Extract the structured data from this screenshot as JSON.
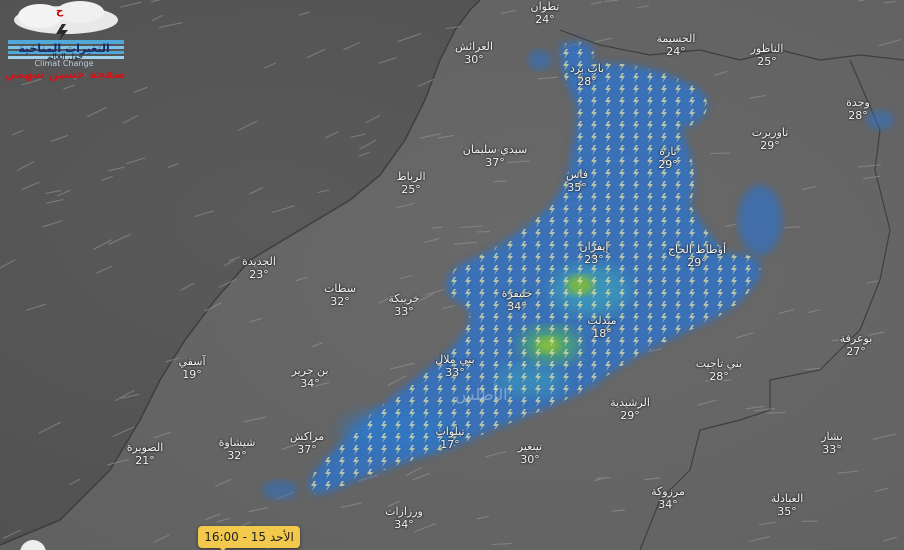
{
  "logo": {
    "line1": "التغيرات المناخية",
    "line2": "حول العالم",
    "line3": "Climat Change",
    "line4": "صفحة حسين سهمي",
    "badge": "ح"
  },
  "region_label": "الأطلس",
  "time_badge": "الأحد 15 - 16:00",
  "cities": [
    {
      "name": "تطوان",
      "temp": "24°"
    },
    {
      "name": "العرائش",
      "temp": "30°"
    },
    {
      "name": "الحسيمة",
      "temp": "24°"
    },
    {
      "name": "الناظور",
      "temp": "25°"
    },
    {
      "name": "باب برد",
      "temp": "28°"
    },
    {
      "name": "وجدة",
      "temp": "28°"
    },
    {
      "name": "تاوريرت",
      "temp": "29°"
    },
    {
      "name": "سيدي سليمان",
      "temp": "37°"
    },
    {
      "name": "تازة",
      "temp": "29°"
    },
    {
      "name": "الرباط",
      "temp": "25°"
    },
    {
      "name": "فاس",
      "temp": "35°"
    },
    {
      "name": "إيفران",
      "temp": "23°"
    },
    {
      "name": "أوطاط الحاج",
      "temp": "29°"
    },
    {
      "name": "الجديدة",
      "temp": "23°"
    },
    {
      "name": "سطات",
      "temp": "32°"
    },
    {
      "name": "خريبكة",
      "temp": "33°"
    },
    {
      "name": "خنيفرة",
      "temp": "34°"
    },
    {
      "name": "ميدلت",
      "temp": "18°"
    },
    {
      "name": "بوعرفة",
      "temp": "27°"
    },
    {
      "name": "آسفي",
      "temp": "19°"
    },
    {
      "name": "بن جرير",
      "temp": "34°"
    },
    {
      "name": "بني ملال",
      "temp": "33°"
    },
    {
      "name": "بني تاجيت",
      "temp": "28°"
    },
    {
      "name": "الرشيدية",
      "temp": "29°"
    },
    {
      "name": "الصويرة",
      "temp": "21°"
    },
    {
      "name": "شيشاوة",
      "temp": "32°"
    },
    {
      "name": "مراكش",
      "temp": "37°"
    },
    {
      "name": "تيلوات",
      "temp": "17°"
    },
    {
      "name": "تينغير",
      "temp": "30°"
    },
    {
      "name": "بشار",
      "temp": "33°"
    },
    {
      "name": "مرزوكة",
      "temp": "34°"
    },
    {
      "name": "ورزازات",
      "temp": "34°"
    },
    {
      "name": "العبادلة",
      "temp": "35°"
    }
  ]
}
